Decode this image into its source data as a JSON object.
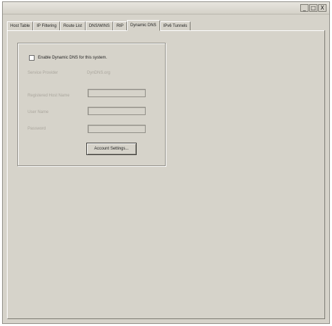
{
  "window": {
    "controls": [
      "_",
      "□",
      "X"
    ]
  },
  "tabs": [
    {
      "label": "Host Table",
      "active": false
    },
    {
      "label": "IP Filtering",
      "active": false
    },
    {
      "label": "Route List",
      "active": false
    },
    {
      "label": "DNS/WINS",
      "active": false
    },
    {
      "label": "RIP",
      "active": false
    },
    {
      "label": "Dynamic DNS",
      "active": true
    },
    {
      "label": "IPv6 Tunnels",
      "active": false
    }
  ],
  "dynamic_dns": {
    "enable_checkbox_label": "Enable Dynamic DNS for this system.",
    "enable_checked": false,
    "service_provider_label": "Service Provider",
    "service_provider_value": "DynDNS.org",
    "hostname_label": "Registered Host Name",
    "username_label": "User Name",
    "password_label": "Password",
    "hostname_value": "",
    "username_value": "",
    "password_value": "",
    "account_settings_button": "Account Settings..."
  },
  "colors": {
    "dialog_background": "#d6d3ca",
    "disabled_text": "#aaa69d"
  }
}
